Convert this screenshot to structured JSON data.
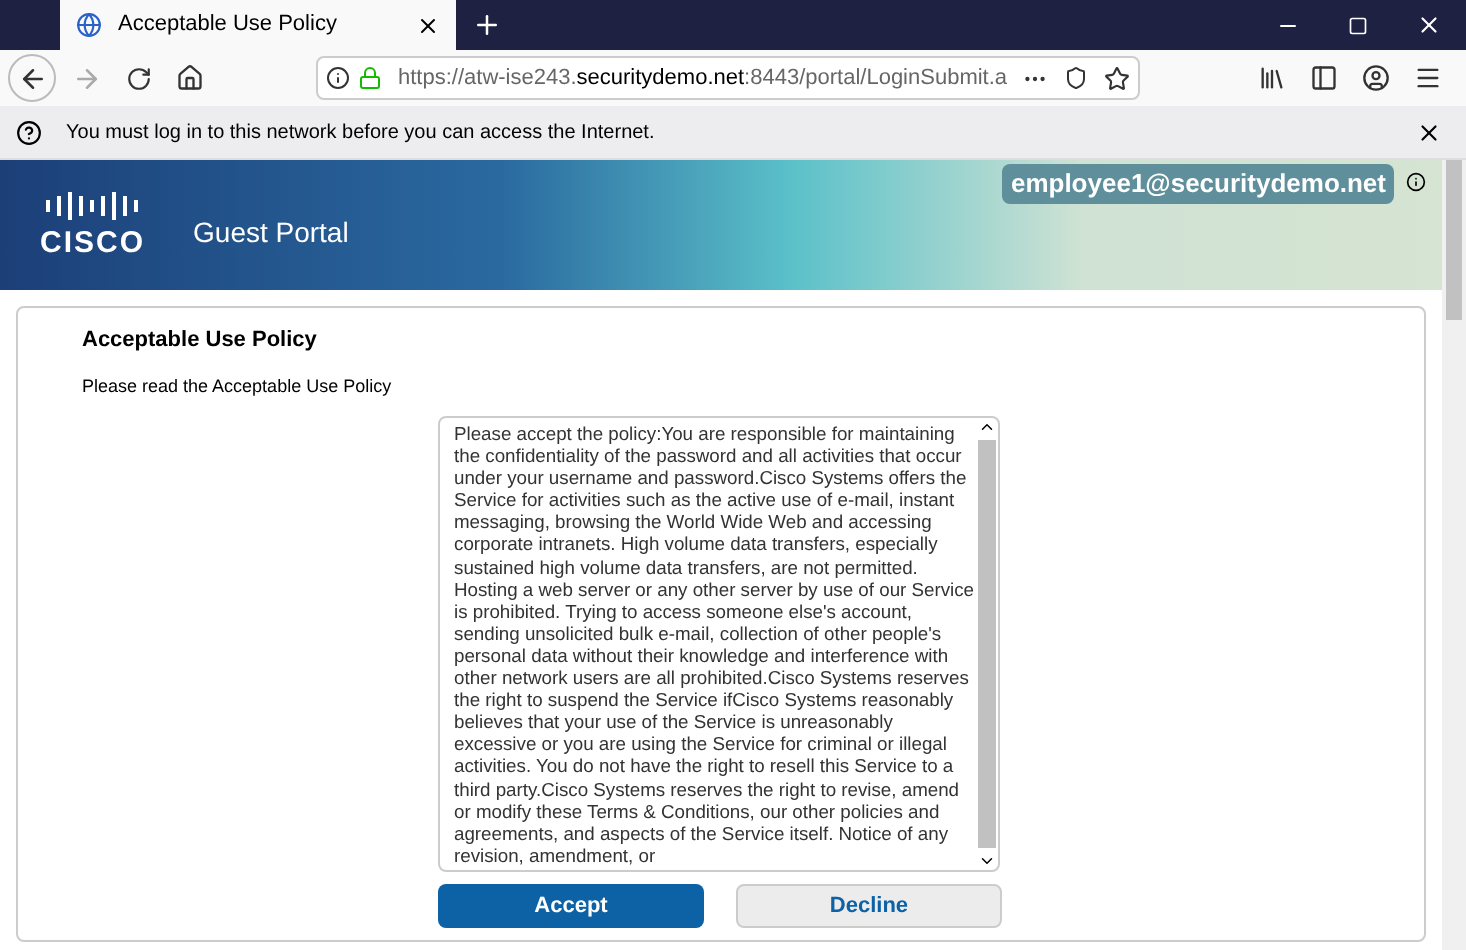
{
  "tab": {
    "title": "Acceptable Use Policy",
    "selected": true
  },
  "address_bar": {
    "prefix": "https://atw-ise243.",
    "domain": "securitydemo.net",
    "suffix": ":8443/portal/LoginSubmit.a"
  },
  "notification": {
    "text": "You must log in to this network before you can access the Internet."
  },
  "banner": {
    "logo": "CISCO",
    "title": "Guest Portal",
    "user": "employee1@securitydemo.net"
  },
  "page": {
    "heading": "Acceptable Use Policy",
    "subheading": "Please read the Acceptable Use Policy",
    "policy_text": "Please accept the policy:You are responsible for maintaining the confidentiality of the password and all activities that occur under your username and password.Cisco Systems offers the Service for activities such as the active use of e-mail, instant messaging, browsing the World Wide Web and accessing corporate intranets. High volume data transfers, especially sustained high volume data transfers, are not permitted. Hosting a web server or any other server by use of our Service is prohibited. Trying to access someone else's account, sending unsolicited bulk e-mail, collection of other people's personal data without their knowledge and interference with other network users are all prohibited.Cisco Systems reserves the right to suspend the Service ifCisco Systems reasonably believes that your use of the Service is unreasonably excessive or you are using the Service for criminal or illegal activities. You do not have the right to resell this Service to a third party.Cisco Systems reserves the right to revise, amend or modify these Terms & Conditions, our other policies and agreements, and aspects of the Service itself. Notice of any revision, amendment, or",
    "buttons": [
      {
        "label": "Accept",
        "kind": "primary"
      },
      {
        "label": "Decline",
        "kind": "secondary"
      }
    ]
  }
}
